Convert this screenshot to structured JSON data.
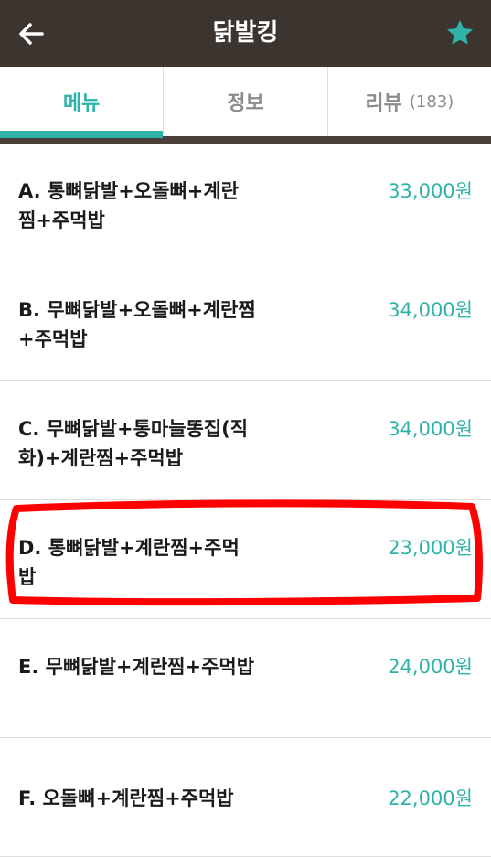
{
  "header": {
    "title": "닭발킹",
    "back_icon": "arrow-left-icon",
    "favorite_icon": "star-icon",
    "favorite_color": "#2fb3a8"
  },
  "tabs": [
    {
      "label": "메뉴",
      "active": true
    },
    {
      "label": "정보",
      "active": false
    },
    {
      "label": "리뷰",
      "count": "(183)",
      "active": false
    }
  ],
  "menu": [
    {
      "name": "A. 통뼈닭발+오돌뼈+계란찜+주먹밥",
      "price": "33,000원"
    },
    {
      "name": "B. 무뼈닭발+오돌뼈+계란찜+주먹밥",
      "price": "34,000원"
    },
    {
      "name": "C. 무뼈닭발+통마늘똥집(직화)+계란찜+주먹밥",
      "price": "34,000원"
    },
    {
      "name": "D. 통뼈닭발+계란찜+주먹밥",
      "price": "23,000원",
      "highlighted": true
    },
    {
      "name": "E. 무뼈닭발+계란찜+주먹밥",
      "price": "24,000원"
    },
    {
      "name": "F. 오돌뼈+계란찜+주먹밥",
      "price": "22,000원"
    }
  ],
  "colors": {
    "header_bg": "#3b342f",
    "accent": "#2fb3a8",
    "highlight": "#ff0000"
  }
}
